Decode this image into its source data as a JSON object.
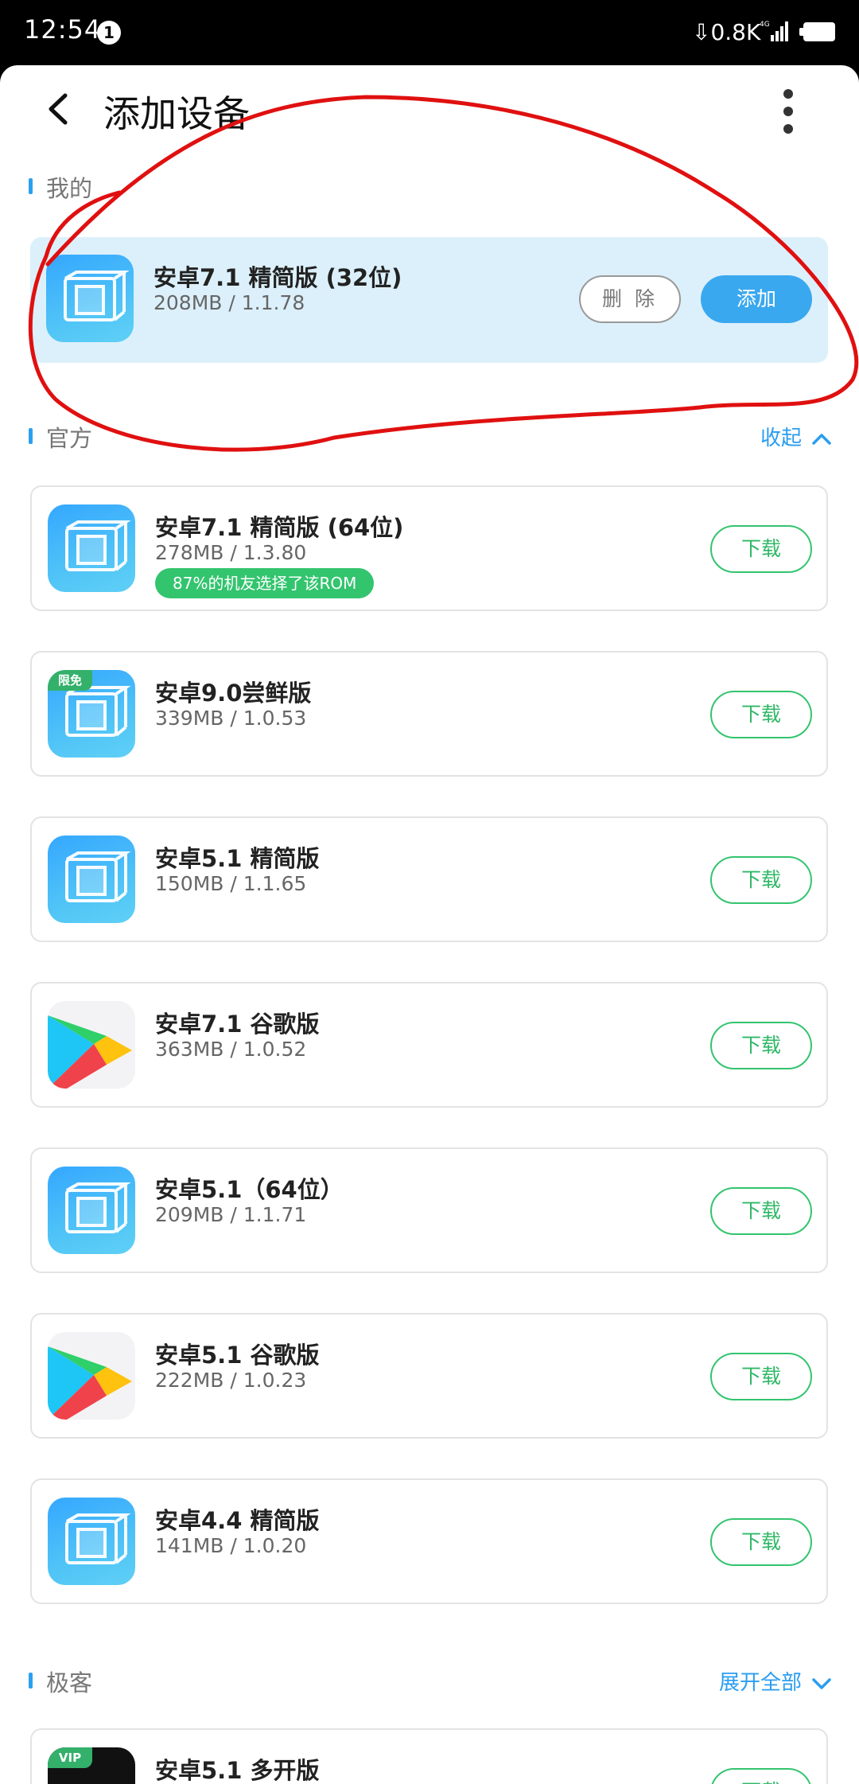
{
  "status_bar": {
    "time": "12:54",
    "notification_count": "1",
    "net_speed": "0.8K",
    "net_type": "4G"
  },
  "header": {
    "title": "添加设备",
    "back_icon": "chevron-left-icon",
    "more_icon": "more-vertical-icon"
  },
  "sections": {
    "mine": {
      "title": "我的"
    },
    "official": {
      "title": "官方",
      "action": "收起"
    },
    "geek": {
      "title": "极客",
      "action": "展开全部"
    }
  },
  "mine_item": {
    "name": "安卓7.1 精简版 (32位)",
    "meta": "208MB / 1.1.78",
    "delete_label": "删 除",
    "add_label": "添加"
  },
  "official_items": [
    {
      "name": "安卓7.1 精简版 (64位)",
      "meta": "278MB / 1.3.80",
      "tag": "87%的机友选择了该ROM",
      "icon": "vm-box-icon",
      "action": "下载"
    },
    {
      "name": "安卓9.0尝鲜版",
      "meta": "339MB / 1.0.53",
      "badge": "限免",
      "icon": "vm-box-icon",
      "action": "下载"
    },
    {
      "name": "安卓5.1 精简版",
      "meta": "150MB / 1.1.65",
      "icon": "vm-box-icon",
      "action": "下载"
    },
    {
      "name": "安卓7.1 谷歌版",
      "meta": "363MB / 1.0.52",
      "icon": "google-play-icon",
      "action": "下载"
    },
    {
      "name": "安卓5.1（64位）",
      "meta": "209MB / 1.1.71",
      "icon": "vm-box-icon",
      "action": "下载"
    },
    {
      "name": "安卓5.1 谷歌版",
      "meta": "222MB / 1.0.23",
      "icon": "google-play-icon",
      "action": "下载"
    },
    {
      "name": "安卓4.4 精简版",
      "meta": "141MB / 1.0.20",
      "icon": "vm-box-icon",
      "action": "下载"
    }
  ],
  "geek_items": [
    {
      "name": "安卓5.1 多开版",
      "badge": "VIP",
      "icon": "vip-app-icon",
      "action": "下载"
    }
  ],
  "colors": {
    "accent_blue": "#2a9df0",
    "download_green": "#33c46e",
    "mine_bg": "#dcf0fb",
    "annotation_red": "#e01010"
  }
}
